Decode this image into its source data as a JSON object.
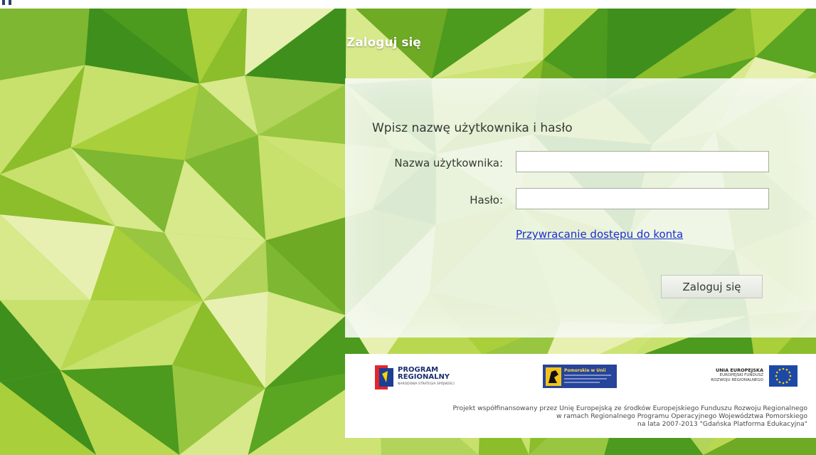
{
  "login": {
    "title": "Zaloguj się",
    "heading": "Wpisz nazwę użytkownika i hasło",
    "username_label": "Nazwa użytkownika:",
    "password_label": "Hasło:",
    "username_value": "",
    "password_value": "",
    "recover_link": "Przywracanie dostępu do konta",
    "submit_label": "Zaloguj się"
  },
  "footer": {
    "logo_program_line1": "PROGRAM",
    "logo_program_line2": "REGIONALNY",
    "logo_program_line3": "NARODOWA STRATEGIA SPÓJNOŚCI",
    "logo_pomorskie": "Pomorskie w Unii",
    "logo_eu_line1": "UNIA EUROPEJSKA",
    "logo_eu_line2": "EUROPEJSKI FUNDUSZ",
    "logo_eu_line3": "ROZWOJU REGIONALNEGO",
    "text_line1": "Projekt współfinansowany przez Unię Europejską ze środków Europejskiego Funduszu Rozwoju Regionalnego",
    "text_line2": "w ramach Regionalnego Programu Operacyjnego Województwa Pomorskiego",
    "text_line3": "na lata 2007-2013 \"Gdańska Platforma Edukacyjna\""
  },
  "colors": {
    "link": "#1a2fd1",
    "green_dark": "#3f8f1d",
    "green_light": "#c7e06a"
  }
}
